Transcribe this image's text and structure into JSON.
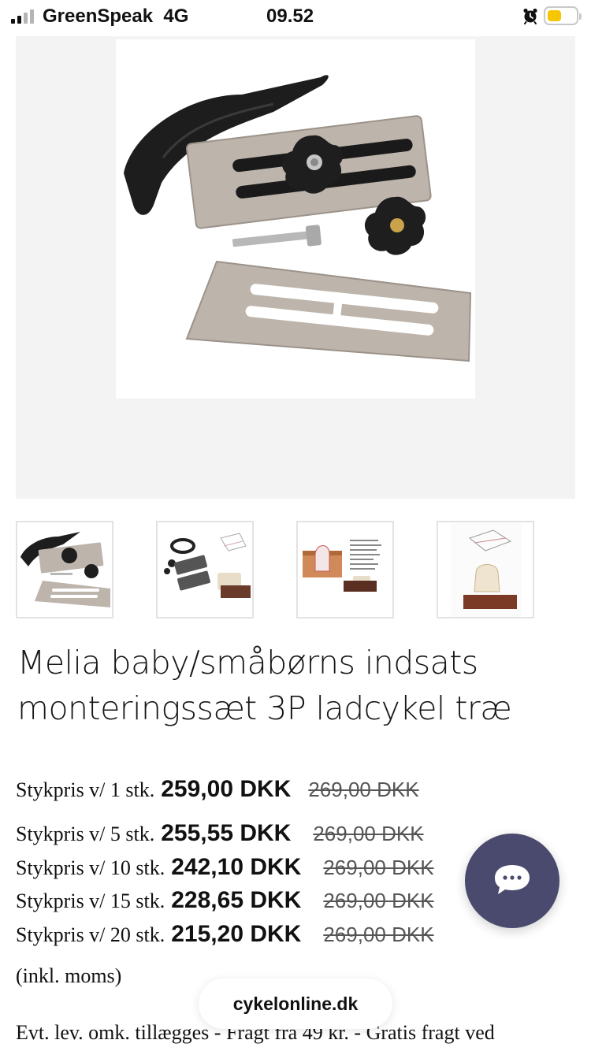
{
  "status_bar": {
    "carrier": "GreenSpeak",
    "network": "4G",
    "time": "09.52",
    "icons": [
      "signal-icon",
      "alarm-icon",
      "battery-icon"
    ],
    "battery_color": "#f6c700"
  },
  "product": {
    "title_line1": "Melia baby/småbørns indsats",
    "title_line2": "monteringssæt 3P ladcykel træ",
    "main_image": "mounting-kit-photo",
    "thumbnails": [
      "mounting-kit-photo",
      "kit-parts-diagram",
      "seat-instruction-sheet",
      "seat-installation-sketch"
    ]
  },
  "prices": [
    {
      "label": "Stykpris v/ 1 stk.",
      "price": "259,00 DKK",
      "old_price": "269,00 DKK"
    },
    {
      "label": "Stykpris v/ 5 stk.",
      "price": "255,55 DKK",
      "old_price": "269,00 DKK"
    },
    {
      "label": "Stykpris v/ 10 stk.",
      "price": "242,10 DKK",
      "old_price": "269,00 DKK"
    },
    {
      "label": "Stykpris v/ 15 stk.",
      "price": "228,65 DKK",
      "old_price": "269,00 DKK"
    },
    {
      "label": "Stykpris v/ 20 stk.",
      "price": "215,20 DKK",
      "old_price": "269,00 DKK"
    }
  ],
  "vat_note": "(inkl. moms)",
  "shipping_note": "Evt. lev. omk. tillægges - Fragt fra 49 kr. - Gratis fragt ved",
  "chat": {
    "icon": "chat-bubble-icon",
    "color": "#494a6e"
  },
  "browser": {
    "domain": "cykelonline.dk"
  }
}
